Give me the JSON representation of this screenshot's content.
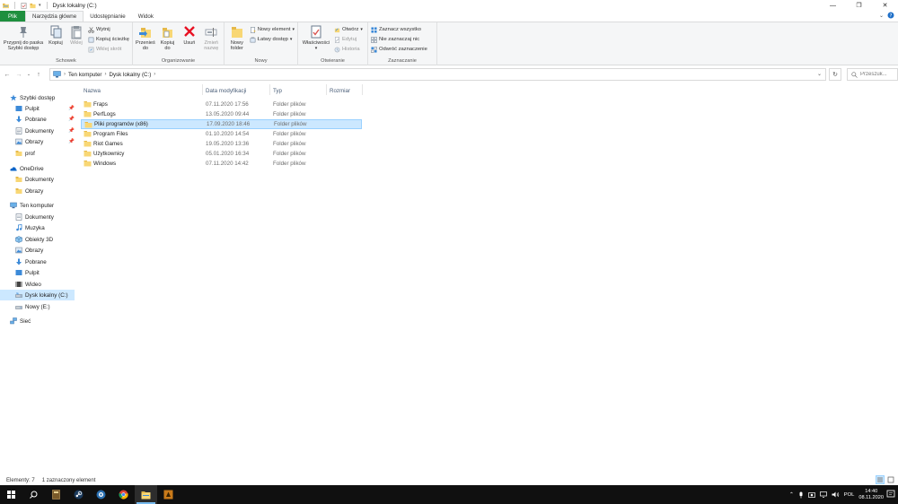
{
  "window": {
    "title": "Dysk lokalny (C:)",
    "controls": {
      "minimize": "—",
      "maximize": "❐",
      "close": "✕"
    }
  },
  "ribbon_tabs": {
    "file": "Plik",
    "home": "Narzędzia główne",
    "share": "Udostępnianie",
    "view": "Widok"
  },
  "ribbon": {
    "clipboard": {
      "label": "Schowek",
      "pin": "Przypnij do paska Szybki dostęp",
      "copy": "Kopiuj",
      "paste": "Wklej",
      "cut": "Wytnij",
      "copy_path": "Kopiuj ścieżkę",
      "paste_shortcut": "Wklej skrót"
    },
    "organize": {
      "label": "Organizowanie",
      "move_to": "Przenieś do",
      "copy_to": "Kopiuj do",
      "delete": "Usuń",
      "rename": "Zmień nazwę"
    },
    "new": {
      "label": "Nowy",
      "new_folder": "Nowy folder",
      "new_item": "Nowy element",
      "easy_access": "Łatwy dostęp"
    },
    "open": {
      "label": "Otwieranie",
      "properties": "Właściwości",
      "open": "Otwórz",
      "edit": "Edytuj",
      "history": "Historia"
    },
    "select": {
      "label": "Zaznaczanie",
      "select_all": "Zaznacz wszystko",
      "select_none": "Nie zaznaczaj nic",
      "invert": "Odwróć zaznaczenie"
    }
  },
  "address": {
    "crumbs": [
      "Ten komputer",
      "Dysk lokalny (C:)"
    ],
    "search_placeholder": "Przeszuk..."
  },
  "nav": {
    "quick_access": "Szybki dostęp",
    "quick_items": [
      "Pulpit",
      "Pobrane",
      "Dokumenty",
      "Obrazy",
      "prof"
    ],
    "onedrive": "OneDrive",
    "onedrive_items": [
      "Dokumenty",
      "Obrazy"
    ],
    "this_pc": "Ten komputer",
    "pc_items": [
      "Dokumenty",
      "Muzyka",
      "Obiekty 3D",
      "Obrazy",
      "Pobrane",
      "Pulpit",
      "Wideo",
      "Dysk lokalny (C:)",
      "Nowy (E:)"
    ],
    "network": "Sieć"
  },
  "columns": {
    "name": "Nazwa",
    "date": "Data modyfikacji",
    "type": "Typ",
    "size": "Rozmiar"
  },
  "files": [
    {
      "name": "Fraps",
      "date": "07.11.2020 17:56",
      "type": "Folder plików",
      "selected": false
    },
    {
      "name": "PerfLogs",
      "date": "13.05.2020 09:44",
      "type": "Folder plików",
      "selected": false
    },
    {
      "name": "Pliki programów (x86)",
      "date": "17.09.2020 18:46",
      "type": "Folder plików",
      "selected": true
    },
    {
      "name": "Program Files",
      "date": "01.10.2020 14:54",
      "type": "Folder plików",
      "selected": false
    },
    {
      "name": "Riot Games",
      "date": "19.05.2020 13:36",
      "type": "Folder plików",
      "selected": false
    },
    {
      "name": "Użytkownicy",
      "date": "05.01.2020 16:34",
      "type": "Folder plików",
      "selected": false
    },
    {
      "name": "Windows",
      "date": "07.11.2020 14:42",
      "type": "Folder plików",
      "selected": false
    }
  ],
  "status": {
    "count": "Elementy: 7",
    "selected": "1 zaznaczony element"
  },
  "taskbar": {
    "language": "POL",
    "time": "14:40",
    "date": "08.11.2020",
    "apps": [
      "start-icon",
      "search-icon",
      "book-app-icon",
      "steam-icon",
      "app-icon",
      "chrome-icon",
      "file-explorer-icon",
      "game-icon"
    ]
  },
  "colors": {
    "file_tab": "#1e8f3e",
    "selection": "#cce8ff",
    "folder": "#f8d775",
    "delete_red": "#e81123",
    "taskbar": "#101010"
  }
}
